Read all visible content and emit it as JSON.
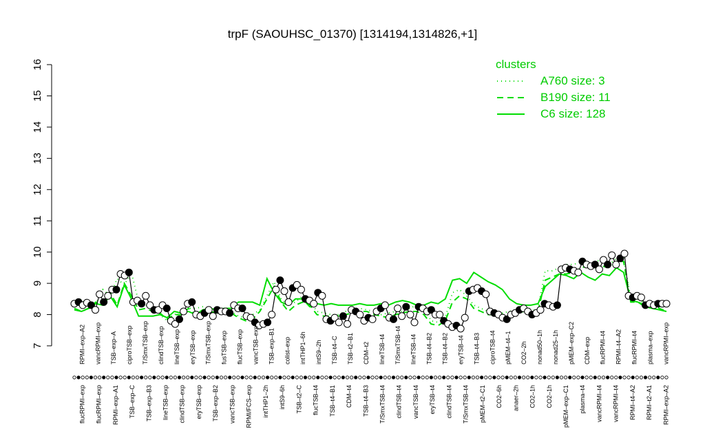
{
  "chart_data": {
    "type": "line",
    "title": "trpF (SAOUHSC_01370) [1314194,1314826,+1]",
    "xlabel": "",
    "ylabel": "",
    "ylim": [
      7,
      16
    ],
    "yticks": [
      "7",
      "8",
      "9",
      "10",
      "11",
      "12",
      "13",
      "14",
      "15",
      "16"
    ],
    "grid": false,
    "legend": {
      "placement": "top-right",
      "title": "clusters",
      "entries": [
        {
          "label": "A760 size: 3",
          "style": "dotted"
        },
        {
          "label": "B190 size: 11",
          "style": "dashed"
        },
        {
          "label": "C6 size: 128",
          "style": "solid"
        }
      ]
    },
    "colors": {
      "lines": "#00dd00",
      "legend_text": "#00cc00",
      "points": "#000000"
    },
    "top_labels": [
      "RPMI–exp–A2",
      "vancRPMI–exp",
      "TSB–exp–A",
      "ciproTSB–exp",
      "T/SmxTSB–exp",
      "clindTSB–exp",
      "lineTSB–exp",
      "eryTSB–exp",
      "T/SmxTSB–exp",
      "fusTSB–exp",
      "flucTSB–exp",
      "vancTSB–exp",
      "TSB–exp–B1",
      "colist–exp",
      "intTHP1–6h",
      "intS9–2h",
      "TSB–t4–C",
      "TSB–t2–B1",
      "CDM–t2",
      "lineTSB–t4",
      "T/SmxTSB–t4",
      "lineTSB–t4",
      "TSB–t4–B2",
      "TSB–t4–B2",
      "eryTSB–t4",
      "TSB–t4–B3",
      "ciproTSB–t4",
      "pMEM–t4–1",
      "CO2–2h",
      "nonad50–1h",
      "nonad25–1h",
      "pMEM–exp–C2",
      "CDM–exp",
      "flucRPMI–t4",
      "RPMI–t4–A2",
      "flucRPMI–t4",
      "plasma–exp",
      "vancRPMI–exp"
    ],
    "bottom_labels": [
      "flucRPMI–exp",
      "flucRPMI–exp",
      "RPMI–exp–A1",
      "TSB–exp–C",
      "TSB–exp–B3",
      "lineTSB–exp",
      "clindTSB–exp",
      "eryTSB–exp",
      "TSB–exp–B2",
      "vancTSB–exp",
      "RPMI/FCS–exp",
      "intTHP1–2h",
      "intS9–6h",
      "TSB–t2–C",
      "flucTSB–t4",
      "TSB–t4–B1",
      "CDM–t4",
      "TSB–t4–B3",
      "T/SmxTSB–t4",
      "clindTSB–t4",
      "vancTSB–t4",
      "eryTSB–t4",
      "clindTSB–t4",
      "T/SmxTSB–t4",
      "pMEM–t2–C1",
      "CO2–6h",
      "anaer–2h",
      "CO2–1h",
      "CO2–1h",
      "pMEM–exp–C1",
      "plasma–t4",
      "vancRPMI–t4",
      "vancRPMI–t4",
      "RPMI–t4–A2",
      "RPMI–t2–A1",
      "RPMI–exp–A2"
    ],
    "x": [
      1,
      2,
      3,
      4,
      5,
      6,
      7,
      8,
      9,
      10,
      11,
      12,
      13,
      14,
      15,
      16,
      17,
      18,
      19,
      20,
      21,
      22,
      23,
      24,
      25,
      26,
      27,
      28,
      29,
      30,
      31,
      32,
      33,
      34,
      35,
      36,
      37,
      38,
      39,
      40,
      41,
      42,
      43,
      44,
      45,
      46,
      47,
      48,
      49,
      50,
      51,
      52,
      53,
      54,
      55,
      56,
      57,
      58,
      59,
      60,
      61,
      62,
      63,
      64,
      65,
      66,
      67,
      68,
      69,
      70,
      71,
      72,
      73,
      74,
      75,
      76,
      77,
      78,
      79,
      80,
      81,
      82,
      83,
      84,
      85,
      86,
      87,
      88,
      89,
      90,
      91,
      92,
      93,
      94,
      95,
      96,
      97,
      98,
      99,
      100,
      101,
      102,
      103,
      104,
      105,
      106,
      107,
      108,
      109,
      110,
      111,
      112,
      113,
      114,
      115,
      116,
      117,
      118,
      119,
      120,
      121,
      122,
      123,
      124,
      125,
      126,
      127,
      128,
      129,
      130,
      131,
      132,
      133,
      134,
      135,
      136,
      137,
      138,
      139,
      140,
      141,
      142
    ],
    "points": [
      8.35,
      8.4,
      8.3,
      8.38,
      8.3,
      8.15,
      8.65,
      8.4,
      8.6,
      8.8,
      8.8,
      9.3,
      9.25,
      9.35,
      8.4,
      8.45,
      8.35,
      8.6,
      8.3,
      8.15,
      8.15,
      8.3,
      8.2,
      7.8,
      7.7,
      7.85,
      8.1,
      8.35,
      8.4,
      8.0,
      7.95,
      8.05,
      8.15,
      7.95,
      8.15,
      8.1,
      8.1,
      8.05,
      8.3,
      8.2,
      8.2,
      7.95,
      7.9,
      7.75,
      7.65,
      7.7,
      7.75,
      8.0,
      8.8,
      9.1,
      8.75,
      8.4,
      8.85,
      8.95,
      8.8,
      8.5,
      8.45,
      8.35,
      8.7,
      8.6,
      7.85,
      7.8,
      7.9,
      7.75,
      7.95,
      7.7,
      8.15,
      8.1,
      8.0,
      7.8,
      7.9,
      7.85,
      8.1,
      8.2,
      8.3,
      7.9,
      7.85,
      8.2,
      7.95,
      8.25,
      8.0,
      7.75,
      8.25,
      8.2,
      8.1,
      8.15,
      8.0,
      8.0,
      7.8,
      7.7,
      7.6,
      7.65,
      7.55,
      7.9,
      8.75,
      8.8,
      8.85,
      8.75,
      8.65,
      8.1,
      8.05,
      8.0,
      7.9,
      7.85,
      8.0,
      8.05,
      8.15,
      8.2,
      8.1,
      8.0,
      8.05,
      8.15,
      8.35,
      8.3,
      8.25,
      8.3,
      9.45,
      9.5,
      9.45,
      9.4,
      9.35,
      9.7,
      9.6,
      9.55,
      9.6,
      9.45,
      9.75,
      9.6,
      9.9,
      9.6,
      9.8,
      9.95,
      8.6,
      8.55,
      8.6,
      8.55,
      8.3,
      8.35,
      8.3,
      8.35,
      8.35,
      8.35
    ],
    "series": [
      {
        "name": "A760 size: 3",
        "style": "dotted",
        "values": [
          8.3,
          8.5,
          8.2,
          8.35,
          8.8,
          8.6,
          9.15,
          8.95,
          9.35,
          8.4,
          8.3,
          8.25,
          8.0,
          7.8,
          8.0,
          8.1,
          8.2,
          8.2,
          8.25,
          8.2,
          8.1,
          8.1,
          8.1,
          7.95,
          7.9,
          8.0,
          8.15,
          8.6,
          9.05,
          8.5,
          8.3,
          8.4,
          8.6,
          8.45,
          8.1,
          8.05,
          8.0,
          8.0,
          8.1,
          8.1,
          8.2,
          8.15,
          8.1,
          8.0,
          8.05,
          8.1,
          8.1,
          8.2,
          8.3,
          8.25,
          7.8,
          7.75,
          7.9,
          8.7,
          8.8,
          8.6,
          8.3,
          8.2,
          8.1,
          8.1,
          8.05,
          8.1,
          8.15,
          8.2,
          8.1,
          8.2,
          9.4,
          9.4,
          9.5,
          9.6,
          9.6,
          9.7,
          9.6,
          9.7,
          9.75,
          9.6,
          9.8,
          9.8,
          8.5,
          8.5,
          8.35,
          8.4,
          8.3,
          8.3
        ]
      },
      {
        "name": "B190 size: 11",
        "style": "dashed",
        "values": [
          8.2,
          8.1,
          8.2,
          8.4,
          8.35,
          8.7,
          8.3,
          9.0,
          8.6,
          8.15,
          8.2,
          8.1,
          8.05,
          7.85,
          8.0,
          8.0,
          8.2,
          8.0,
          8.1,
          8.1,
          8.05,
          8.1,
          8.05,
          7.9,
          7.8,
          7.85,
          8.1,
          8.5,
          8.9,
          8.4,
          8.1,
          8.3,
          8.4,
          8.3,
          8.0,
          7.95,
          7.95,
          7.95,
          8.0,
          8.05,
          8.1,
          8.1,
          8.0,
          7.95,
          7.9,
          8.0,
          8.05,
          8.1,
          8.1,
          8.0,
          7.7,
          7.65,
          7.8,
          8.4,
          8.6,
          8.5,
          8.2,
          8.1,
          8.0,
          8.0,
          8.0,
          8.0,
          8.05,
          8.1,
          8.05,
          8.1,
          9.1,
          9.2,
          9.3,
          9.3,
          9.35,
          9.5,
          9.55,
          9.5,
          9.55,
          9.5,
          9.7,
          9.7,
          8.4,
          8.4,
          8.3,
          8.3,
          8.2,
          8.1
        ]
      },
      {
        "name": "C6 size: 128",
        "style": "solid",
        "values": [
          8.15,
          8.1,
          8.2,
          8.35,
          8.3,
          8.6,
          8.25,
          8.95,
          8.5,
          7.95,
          7.95,
          7.95,
          8.0,
          7.9,
          8.1,
          8.05,
          8.1,
          8.0,
          8.15,
          8.2,
          8.15,
          8.2,
          8.2,
          8.4,
          8.4,
          8.4,
          8.3,
          9.15,
          8.7,
          8.4,
          8.3,
          8.5,
          8.5,
          8.25,
          8.35,
          8.3,
          8.35,
          8.3,
          8.3,
          8.3,
          8.35,
          8.3,
          8.3,
          8.35,
          8.3,
          8.4,
          8.45,
          8.4,
          8.3,
          8.3,
          8.4,
          8.35,
          8.5,
          9.1,
          9.15,
          9.0,
          9.35,
          9.2,
          9.05,
          8.95,
          8.8,
          8.5,
          8.35,
          8.3,
          8.3,
          8.35,
          8.9,
          9.1,
          9.3,
          9.25,
          9.15,
          9.35,
          9.2,
          9.1,
          9.3,
          9.25,
          9.5,
          9.35,
          8.45,
          8.4,
          8.25,
          8.2,
          8.15,
          8.1
        ]
      }
    ]
  }
}
